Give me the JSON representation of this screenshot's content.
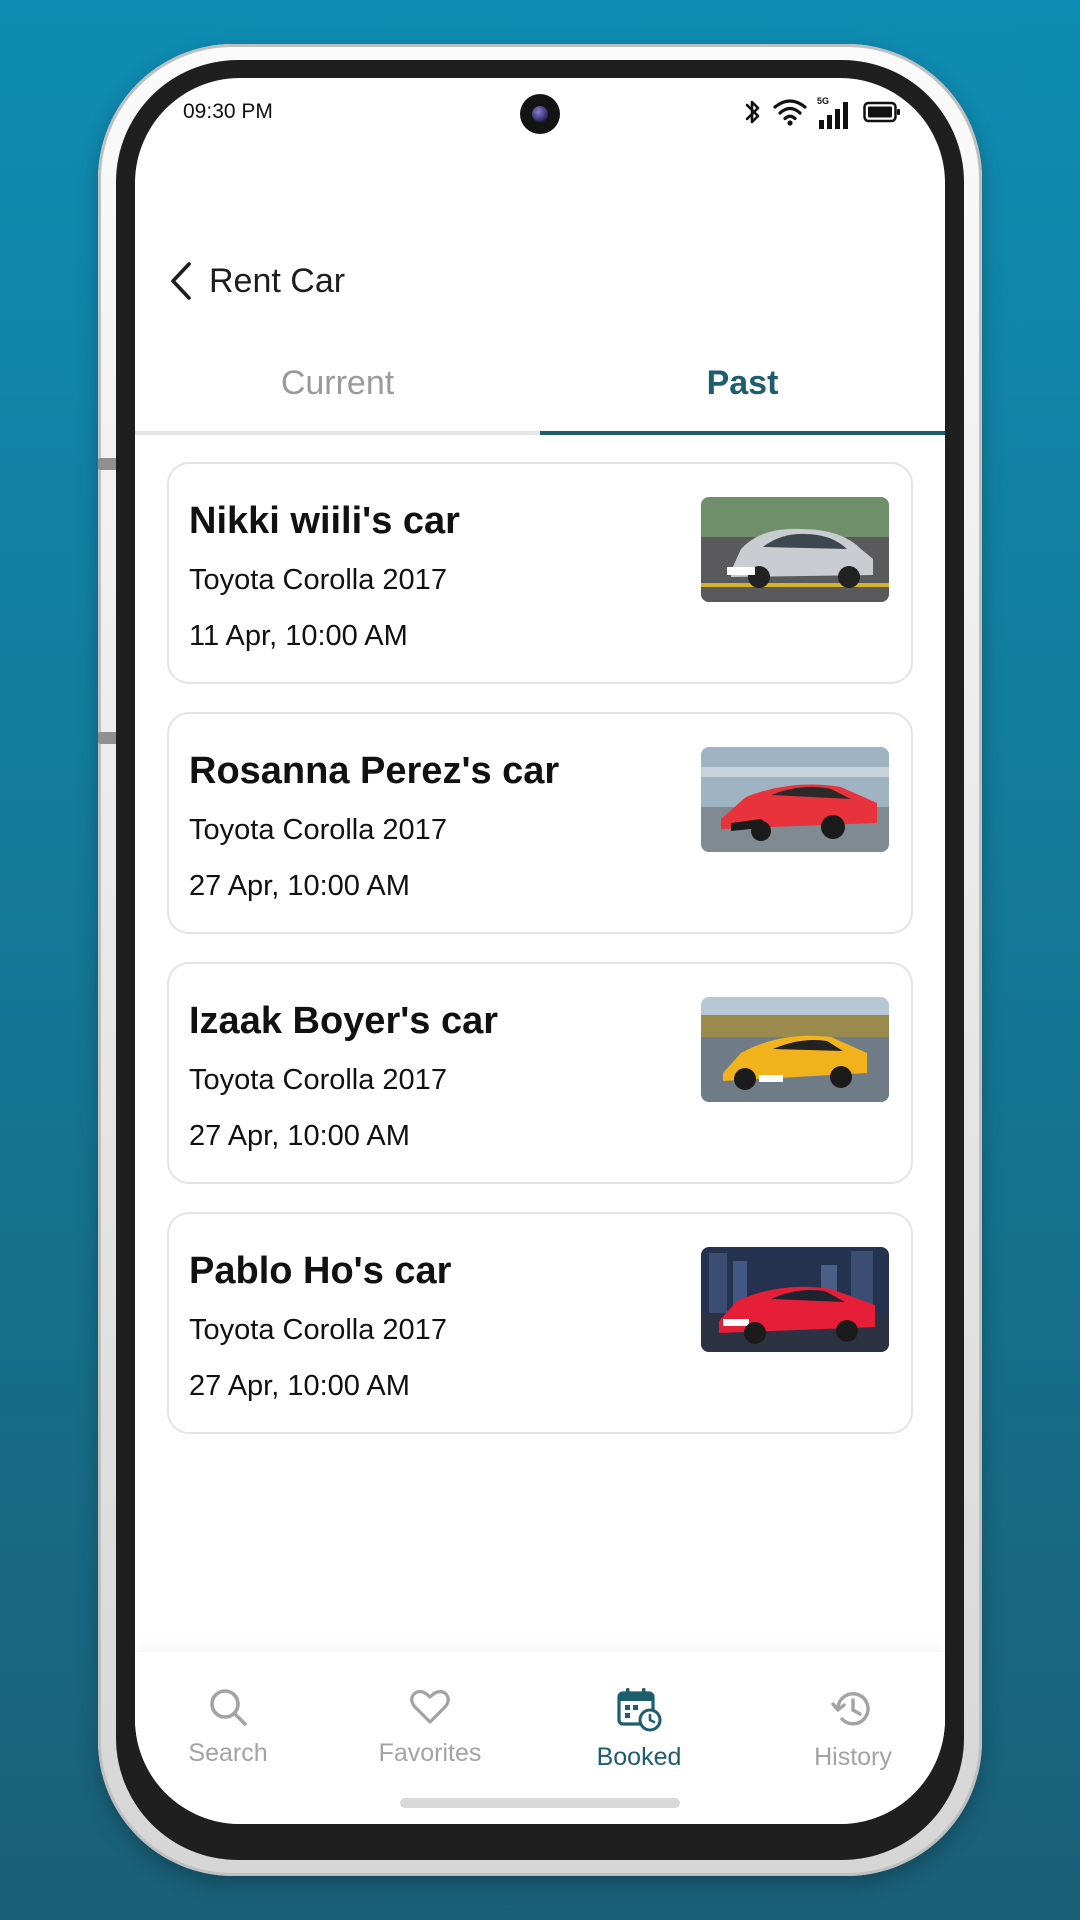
{
  "status_bar": {
    "time": "09:30 PM",
    "network_label": "5G"
  },
  "header": {
    "title": "Rent Car"
  },
  "tabs": [
    {
      "label": "Current",
      "active": false
    },
    {
      "label": "Past",
      "active": true
    }
  ],
  "bookings": [
    {
      "name": "Nikki wiili's car",
      "model": "Toyota Corolla 2017",
      "date": "11 Apr, 10:00 AM",
      "thumb_color": "#c9ccd0"
    },
    {
      "name": "Rosanna Perez's car",
      "model": "Toyota Corolla 2017",
      "date": "27 Apr, 10:00 AM",
      "thumb_color": "#e8333d"
    },
    {
      "name": "Izaak Boyer's car",
      "model": "Toyota Corolla 2017",
      "date": "27 Apr, 10:00 AM",
      "thumb_color": "#f2b21c"
    },
    {
      "name": "Pablo Ho's car",
      "model": "Toyota Corolla 2017",
      "date": "27 Apr, 10:00 AM",
      "thumb_color": "#e61e37"
    }
  ],
  "bottom_nav": [
    {
      "label": "Search",
      "icon": "search-icon",
      "active": false
    },
    {
      "label": "Favorites",
      "icon": "heart-icon",
      "active": false
    },
    {
      "label": "Booked",
      "icon": "calendar-clock-icon",
      "active": true
    },
    {
      "label": "History",
      "icon": "history-icon",
      "active": false
    }
  ],
  "colors": {
    "accent": "#1c5d6e",
    "inactive": "#a3a3a3",
    "background_top": "#0f8cb3",
    "background_bottom": "#1a5f78"
  }
}
